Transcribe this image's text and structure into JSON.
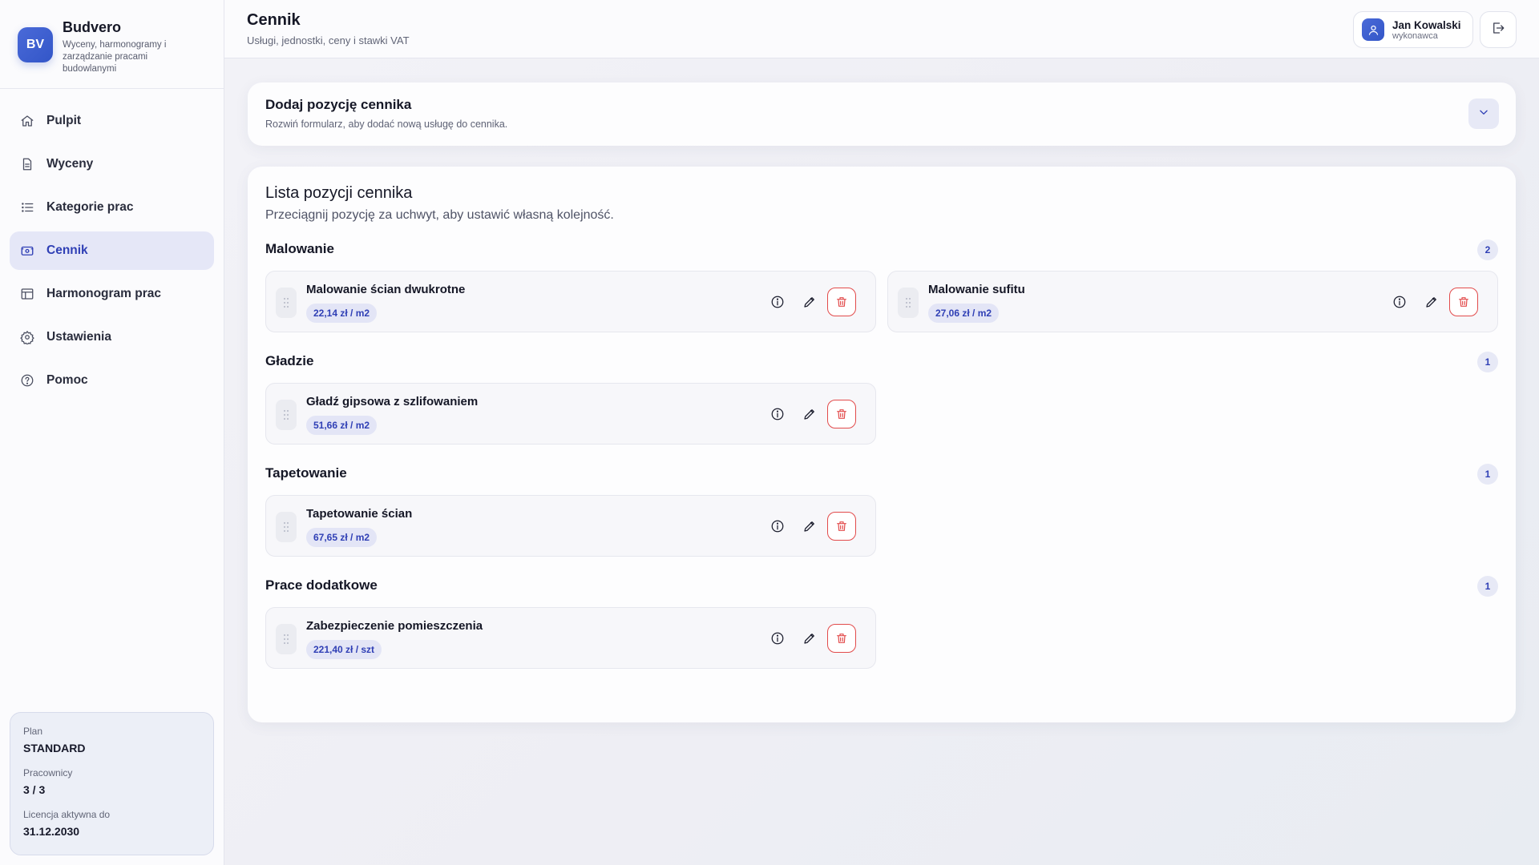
{
  "app": {
    "logo": "BV",
    "name": "Budvero",
    "tagline": "Wyceny, harmonogramy i zarządzanie pracami budowlanymi"
  },
  "nav": [
    {
      "label": "Pulpit",
      "icon": "home-icon",
      "active": false
    },
    {
      "label": "Wyceny",
      "icon": "document-icon",
      "active": false
    },
    {
      "label": "Kategorie prac",
      "icon": "list-icon",
      "active": false
    },
    {
      "label": "Cennik",
      "icon": "price-tag-icon",
      "active": true
    },
    {
      "label": "Harmonogram prac",
      "icon": "calendar-icon",
      "active": false
    },
    {
      "label": "Ustawienia",
      "icon": "gear-icon",
      "active": false
    },
    {
      "label": "Pomoc",
      "icon": "help-icon",
      "active": false
    }
  ],
  "plan": {
    "plan_label": "Plan",
    "plan_value": "STANDARD",
    "workers_label": "Pracownicy",
    "workers_value": "3 / 3",
    "license_label": "Licencja aktywna do",
    "license_value": "31.12.2030"
  },
  "header": {
    "title": "Cennik",
    "subtitle": "Usługi, jednostki, ceny i stawki VAT"
  },
  "user": {
    "name": "Jan Kowalski",
    "role": "wykonawca"
  },
  "add_panel": {
    "title": "Dodaj pozycję cennika",
    "subtitle": "Rozwiń formularz, aby dodać nową usługę do cennika."
  },
  "list": {
    "title": "Lista pozycji cennika",
    "subtitle": "Przeciągnij pozycję za uchwyt, aby ustawić własną kolejność.",
    "sections": [
      {
        "name": "Malowanie",
        "count": "2",
        "items": [
          {
            "name": "Malowanie ścian dwukrotne",
            "price": "22,14 zł / m2"
          },
          {
            "name": "Malowanie sufitu",
            "price": "27,06 zł / m2"
          }
        ]
      },
      {
        "name": "Gładzie",
        "count": "1",
        "items": [
          {
            "name": "Gładź gipsowa z szlifowaniem",
            "price": "51,66 zł / m2"
          }
        ]
      },
      {
        "name": "Tapetowanie",
        "count": "1",
        "items": [
          {
            "name": "Tapetowanie ścian",
            "price": "67,65 zł / m2"
          }
        ]
      },
      {
        "name": "Prace dodatkowe",
        "count": "1",
        "items": [
          {
            "name": "Zabezpieczenie pomieszczenia",
            "price": "221,40 zł / szt"
          }
        ]
      }
    ]
  },
  "colors": {
    "accent": "#2f3fb5",
    "brand": "#3f5fd0",
    "danger": "#e24b4b",
    "active_nav_bg": "#e5e7f7"
  }
}
